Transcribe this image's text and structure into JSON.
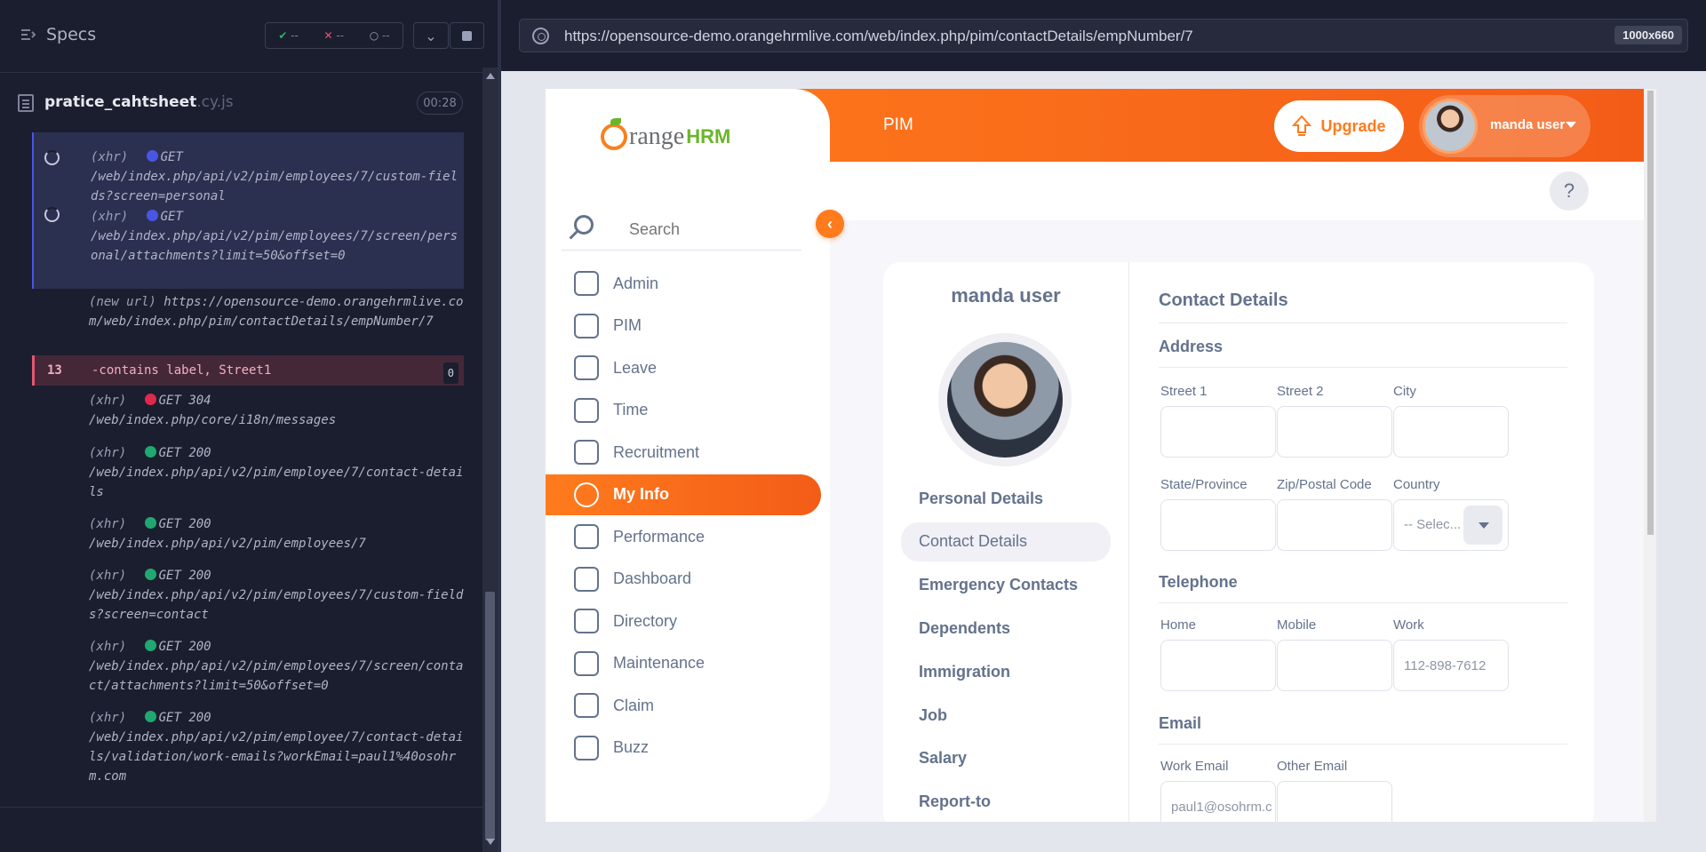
{
  "cypress": {
    "specs_label": "Specs",
    "stats": {
      "passed": "--",
      "failed": "--",
      "pending": "--"
    },
    "spec_file": {
      "name": "pratice_cahtsheet",
      "ext": ".cy.js",
      "duration": "00:28"
    },
    "commands": [
      {
        "kind": "xhr",
        "prefix": "(xhr)",
        "method": "GET",
        "status": "",
        "url": "/web/index.php/api/v2/pim/employees/7/custom-fields?screen=personal",
        "state": "pending"
      },
      {
        "kind": "xhr",
        "prefix": "(xhr)",
        "method": "GET",
        "status": "",
        "url": "/web/index.php/api/v2/pim/employees/7/screen/personal/attachments?limit=50&offset=0",
        "state": "pending"
      },
      {
        "kind": "url",
        "prefix": "(new url)",
        "url": "https://opensource-demo.orangehrmlive.com/web/index.php/pim/contactDetails/empNumber/7"
      },
      {
        "kind": "error",
        "number": "13",
        "text": "-contains  label, Street1",
        "badge": "0"
      },
      {
        "kind": "xhr",
        "prefix": "(xhr)",
        "method": "GET",
        "status": "304",
        "url": "/web/index.php/core/i18n/messages",
        "state": "error"
      },
      {
        "kind": "xhr",
        "prefix": "(xhr)",
        "method": "GET",
        "status": "200",
        "url": "/web/index.php/api/v2/pim/employee/7/contact-details",
        "state": "ok"
      },
      {
        "kind": "xhr",
        "prefix": "(xhr)",
        "method": "GET",
        "status": "200",
        "url": "/web/index.php/api/v2/pim/employees/7",
        "state": "ok"
      },
      {
        "kind": "xhr",
        "prefix": "(xhr)",
        "method": "GET",
        "status": "200",
        "url": "/web/index.php/api/v2/pim/employees/7/custom-fields?screen=contact",
        "state": "ok"
      },
      {
        "kind": "xhr",
        "prefix": "(xhr)",
        "method": "GET",
        "status": "200",
        "url": "/web/index.php/api/v2/pim/employees/7/screen/contact/attachments?limit=50&offset=0",
        "state": "ok"
      },
      {
        "kind": "xhr",
        "prefix": "(xhr)",
        "method": "GET",
        "status": "200",
        "url": "/web/index.php/api/v2/pim/employee/7/contact-details/validation/work-emails?workEmail=paul1%40osohrm.com",
        "state": "ok"
      }
    ],
    "url": "https://opensource-demo.orangehrmlive.com/web/index.php/pim/contactDetails/empNumber/7",
    "viewport": "1000x660",
    "colors": {
      "pending": "#4956e3",
      "ok": "#1fa971",
      "error": "#e0284f"
    }
  },
  "app": {
    "logo": {
      "orange": "range",
      "hrm": "HRM"
    },
    "module_title": "PIM",
    "upgrade_label": "Upgrade",
    "user_name": "manda user",
    "help_label": "?",
    "search_placeholder": "Search",
    "menu": [
      {
        "label": "Admin",
        "icon": "admin-icon",
        "active": false
      },
      {
        "label": "PIM",
        "icon": "pim-icon",
        "active": false
      },
      {
        "label": "Leave",
        "icon": "leave-icon",
        "active": false
      },
      {
        "label": "Time",
        "icon": "time-icon",
        "active": false
      },
      {
        "label": "Recruitment",
        "icon": "recruitment-icon",
        "active": false
      },
      {
        "label": "My Info",
        "icon": "my-info-icon",
        "active": true
      },
      {
        "label": "Performance",
        "icon": "performance-icon",
        "active": false
      },
      {
        "label": "Dashboard",
        "icon": "dashboard-icon",
        "active": false
      },
      {
        "label": "Directory",
        "icon": "directory-icon",
        "active": false
      },
      {
        "label": "Maintenance",
        "icon": "maintenance-icon",
        "active": false
      },
      {
        "label": "Claim",
        "icon": "claim-icon",
        "active": false
      },
      {
        "label": "Buzz",
        "icon": "buzz-icon",
        "active": false
      }
    ],
    "employee_name": "manda user",
    "profile_tabs": [
      "Personal Details",
      "Contact Details",
      "Emergency Contacts",
      "Dependents",
      "Immigration",
      "Job",
      "Salary",
      "Report-to"
    ],
    "active_tab": "Contact Details",
    "form": {
      "title": "Contact Details",
      "address_title": "Address",
      "street1_label": "Street 1",
      "street1_value": "",
      "street2_label": "Street 2",
      "street2_value": "",
      "city_label": "City",
      "city_value": "",
      "state_label": "State/Province",
      "state_value": "",
      "zip_label": "Zip/Postal Code",
      "zip_value": "",
      "country_label": "Country",
      "country_value": "-- Selec...",
      "telephone_title": "Telephone",
      "home_label": "Home",
      "home_value": "",
      "mobile_label": "Mobile",
      "mobile_value": "",
      "work_label": "Work",
      "work_value": "112-898-7612",
      "email_title": "Email",
      "work_email_label": "Work Email",
      "work_email_value": "paul1@osohrm.c",
      "other_email_label": "Other Email",
      "other_email_value": ""
    },
    "colors": {
      "brand": "#ff7b1d",
      "brand_dark": "#f35c17",
      "text": "#64728c",
      "logo_green": "#6cb52b"
    }
  }
}
